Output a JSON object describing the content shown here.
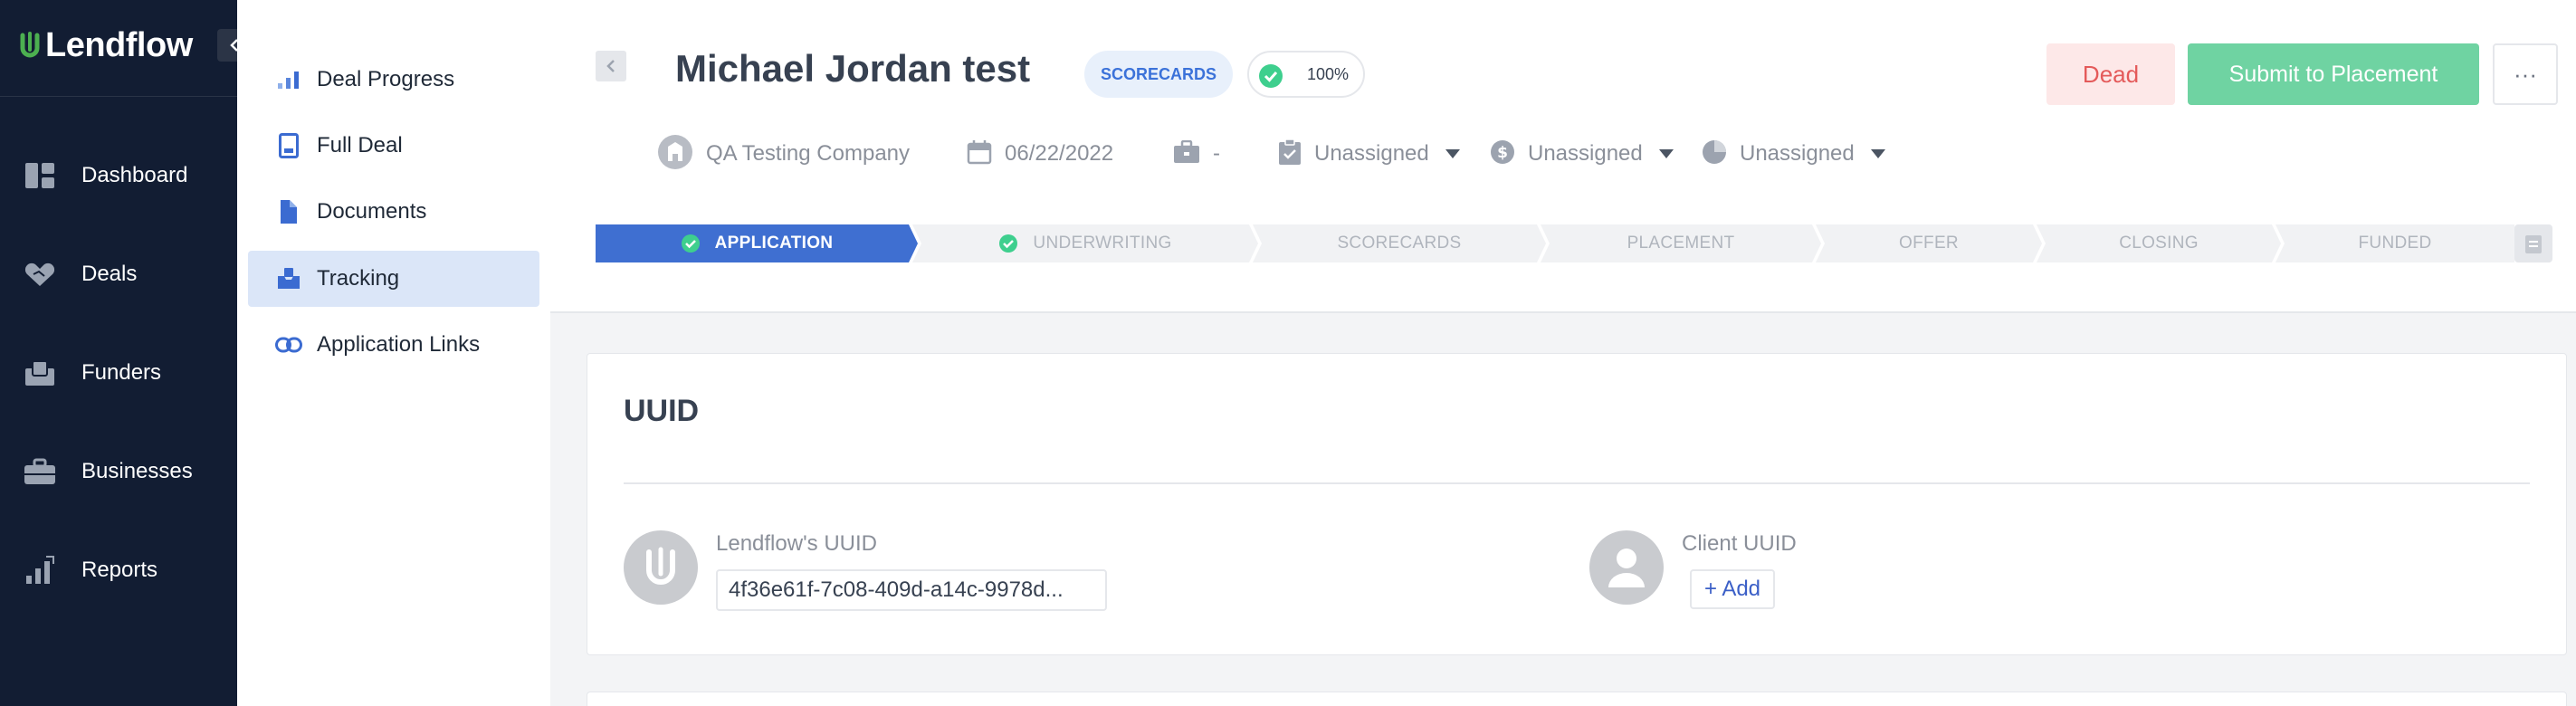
{
  "brand": {
    "name": "Lendflow",
    "accent": "#4f8f3f"
  },
  "leftnav": {
    "items": [
      {
        "label": "Dashboard",
        "icon": "dashboard-icon"
      },
      {
        "label": "Deals",
        "icon": "handshake-icon"
      },
      {
        "label": "Funders",
        "icon": "funders-icon"
      },
      {
        "label": "Businesses",
        "icon": "briefcase-icon"
      },
      {
        "label": "Reports",
        "icon": "reports-icon"
      }
    ]
  },
  "subnav": {
    "items": [
      {
        "label": "Deal Progress",
        "icon": "bar-chart-icon"
      },
      {
        "label": "Full Deal",
        "icon": "document-icon"
      },
      {
        "label": "Documents",
        "icon": "file-icon"
      },
      {
        "label": "Tracking",
        "icon": "inbox-icon",
        "active": true
      },
      {
        "label": "Application Links",
        "icon": "link-icon"
      }
    ]
  },
  "header": {
    "title": "Michael Jordan test",
    "scorecards_badge": "SCORECARDS",
    "completion": "100%",
    "dead_label": "Dead",
    "submit_label": "Submit to Placement",
    "more_label": "···",
    "meta": {
      "company": "QA Testing Company",
      "date": "06/22/2022",
      "product": "-",
      "assignee_1": "Unassigned",
      "assignee_2": "Unassigned",
      "assignee_3": "Unassigned"
    },
    "stages": [
      {
        "label": "APPLICATION",
        "state": "active"
      },
      {
        "label": "UNDERWRITING",
        "state": "done"
      },
      {
        "label": "SCORECARDS",
        "state": "pending"
      },
      {
        "label": "PLACEMENT",
        "state": "pending"
      },
      {
        "label": "OFFER",
        "state": "pending"
      },
      {
        "label": "CLOSING",
        "state": "pending"
      },
      {
        "label": "FUNDED",
        "state": "pending"
      }
    ]
  },
  "uuid_card": {
    "title": "UUID",
    "lendflow_label": "Lendflow's UUID",
    "lendflow_value": "4f36e61f-7c08-409d-a14c-9978d...",
    "client_label": "Client UUID",
    "add_label": "+ Add"
  },
  "colors": {
    "active_stage": "#3f6fd1",
    "check_green": "#3ecf8e",
    "sidebar_bg": "#121d33"
  }
}
